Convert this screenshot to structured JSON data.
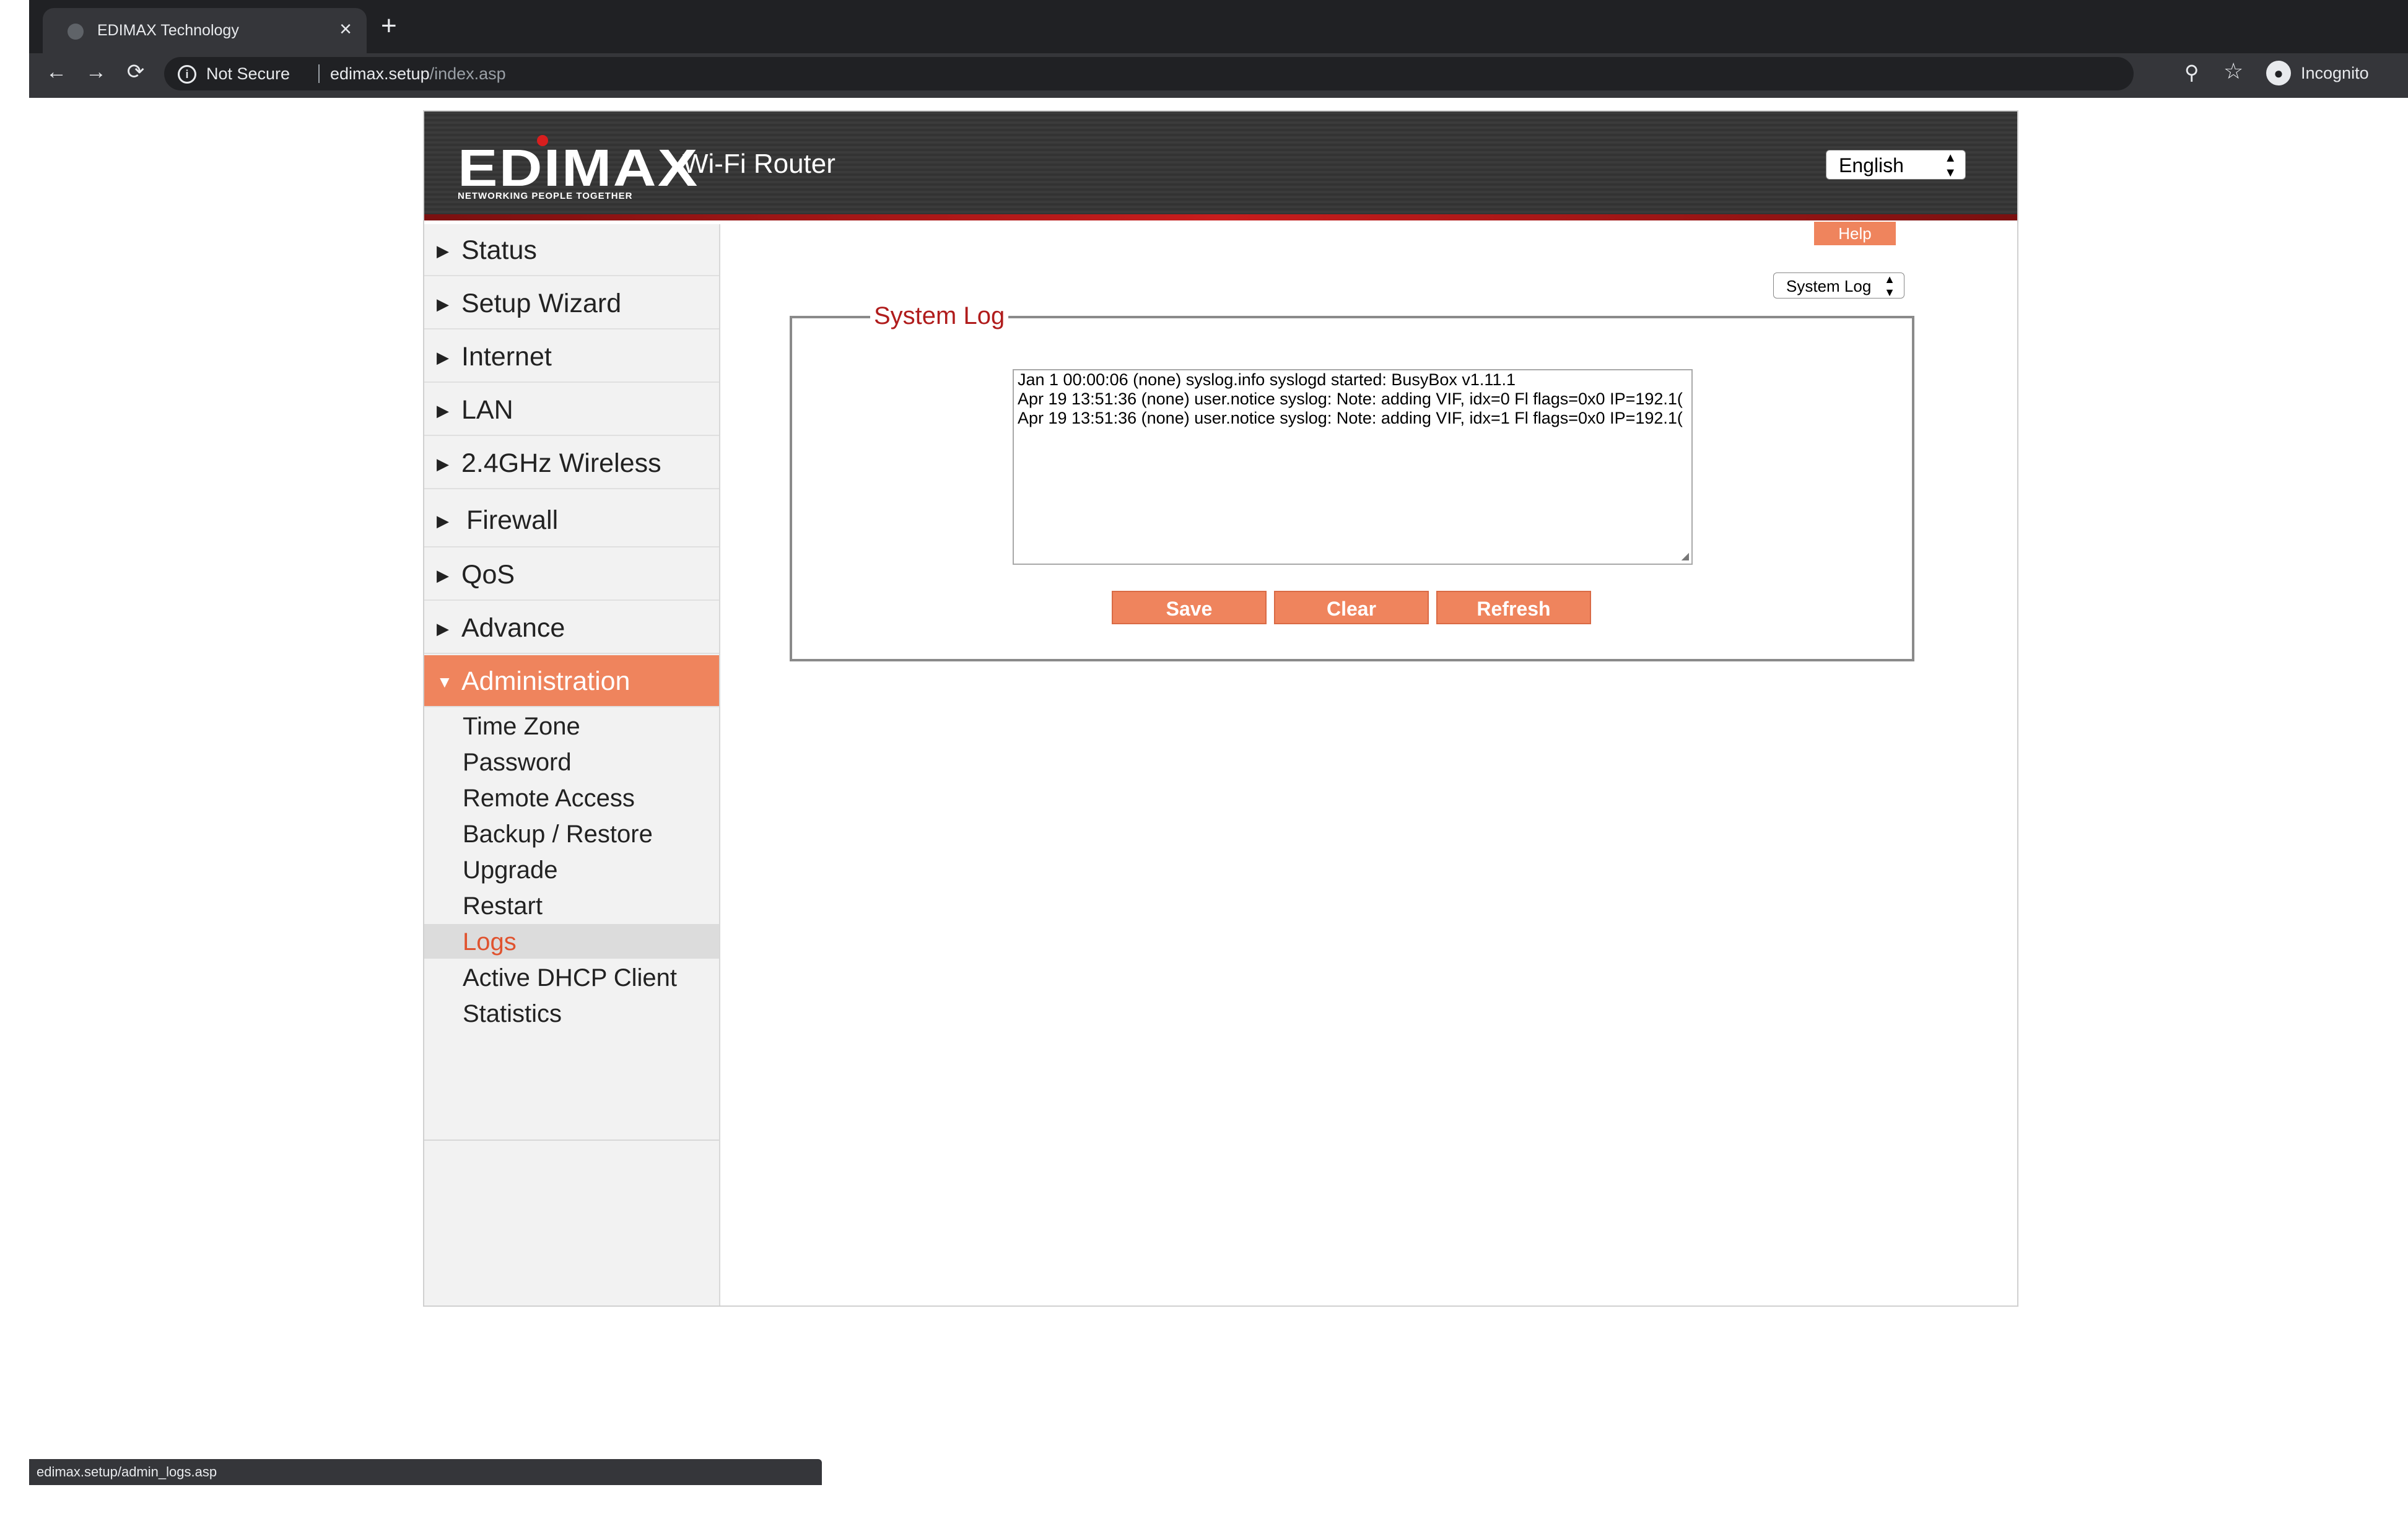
{
  "browser": {
    "tab_title": "EDIMAX Technology",
    "tab_close": "×",
    "new_tab": "+",
    "back": "←",
    "forward": "→",
    "reload": "⟳",
    "security_label": "Not Secure",
    "url_host": "edimax.setup",
    "url_path": "/index.asp",
    "profile_label": "Incognito",
    "status_url": "edimax.setup/admin_logs.asp"
  },
  "header": {
    "brand": "EDIMAX",
    "tagline": "NETWORKING PEOPLE TOGETHER",
    "product": "Wi-Fi Router",
    "language": "English"
  },
  "sidebar": {
    "items": [
      {
        "label": "Status"
      },
      {
        "label": "Setup Wizard"
      },
      {
        "label": "Internet"
      },
      {
        "label": "LAN"
      },
      {
        "label": "2.4GHz Wireless"
      },
      {
        "label": "Firewall"
      },
      {
        "label": "QoS"
      },
      {
        "label": "Advance"
      },
      {
        "label": "Administration",
        "active": true
      }
    ],
    "subitems": [
      {
        "label": "Time Zone"
      },
      {
        "label": "Password"
      },
      {
        "label": "Remote Access"
      },
      {
        "label": "Backup / Restore"
      },
      {
        "label": "Upgrade"
      },
      {
        "label": "Restart"
      },
      {
        "label": "Logs",
        "active": true
      },
      {
        "label": "Active DHCP Client"
      },
      {
        "label": "Statistics"
      }
    ]
  },
  "content": {
    "help_label": "Help",
    "log_type": "System Log",
    "section_title": "System Log",
    "log_lines": [
      "Jan  1 00:00:06 (none) syslog.info syslogd started: BusyBox v1.11.1",
      "Apr 19 13:51:36 (none) user.notice syslog: Note: adding VIF, idx=0 Fl flags=0x0 IP=192.1(",
      "Apr 19 13:51:36 (none) user.notice syslog: Note: adding VIF, idx=1 Fl flags=0x0 IP=192.1("
    ],
    "buttons": {
      "save": "Save",
      "clear": "Clear",
      "refresh": "Refresh"
    }
  },
  "colors": {
    "accent": "#ef845d",
    "legend": "#b01c1c",
    "active_sublink": "#e0532f"
  }
}
